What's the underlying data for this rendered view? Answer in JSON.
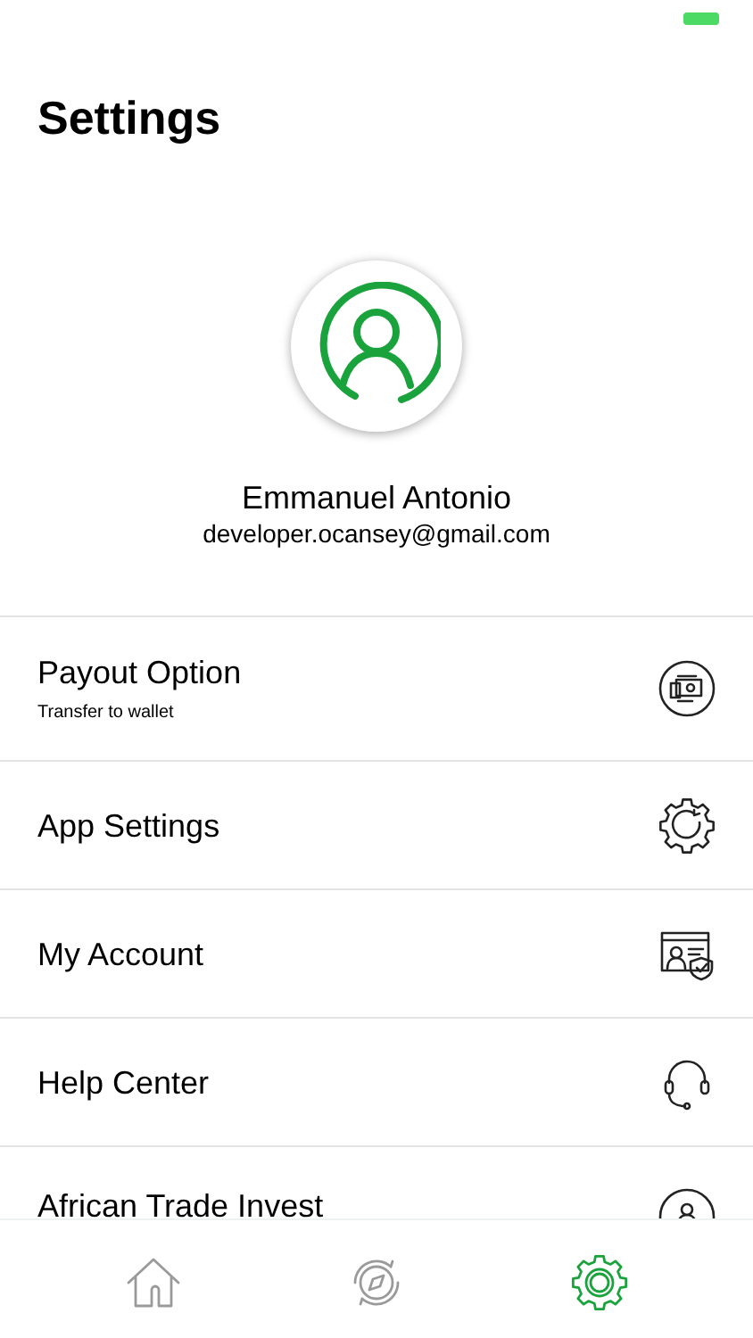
{
  "title": "Settings",
  "profile": {
    "name": "Emmanuel Antonio",
    "email": "developer.ocansey@gmail.com"
  },
  "menu": [
    {
      "kind": "payout",
      "label": "Payout Option",
      "subtitle": "Transfer to wallet"
    },
    {
      "kind": "gear",
      "label": "App Settings"
    },
    {
      "kind": "account",
      "label": "My Account"
    },
    {
      "kind": "help",
      "label": "Help Center"
    },
    {
      "kind": "person",
      "label": "African Trade Invest"
    }
  ],
  "tabs": [
    {
      "kind": "home",
      "selected": false
    },
    {
      "kind": "compass",
      "selected": false
    },
    {
      "kind": "settings",
      "selected": true
    }
  ]
}
